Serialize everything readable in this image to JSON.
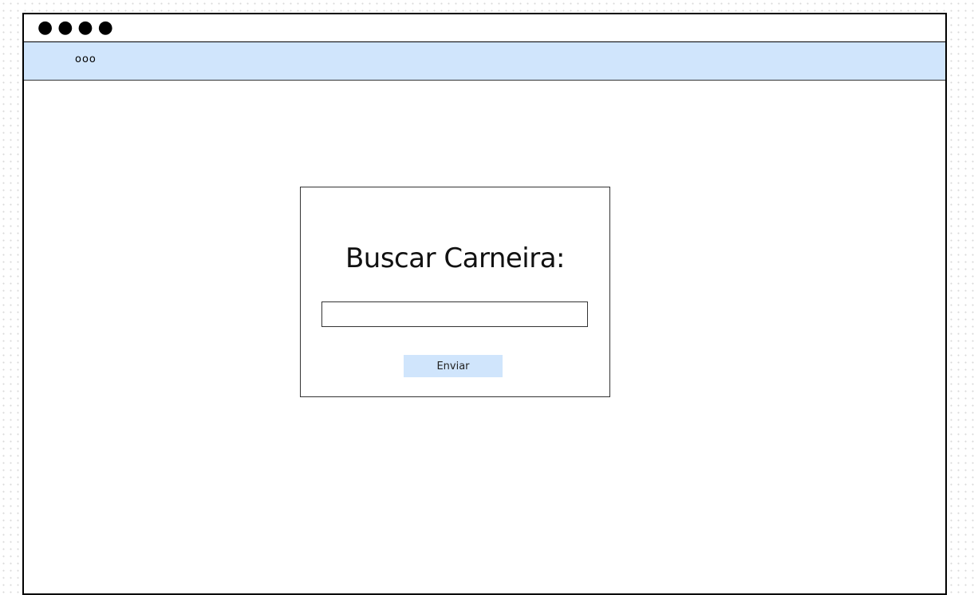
{
  "window": {
    "controls_glyph": "●●●●"
  },
  "navbar": {
    "menu_glyph": "ooo",
    "background": "#d0e5fc"
  },
  "search_panel": {
    "title": "Buscar Carneira:",
    "input_value": "",
    "submit_label": "Enviar",
    "submit_background": "#d0e5fc"
  }
}
